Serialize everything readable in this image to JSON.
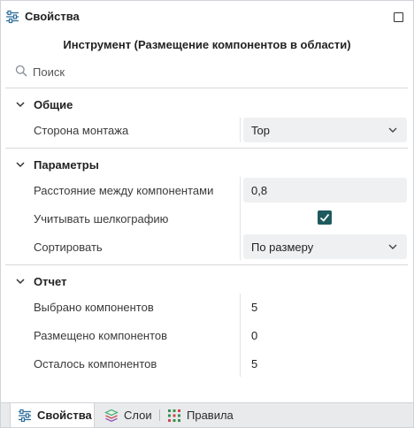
{
  "panel": {
    "title": "Свойства"
  },
  "tool_title": "Инструмент (Размещение компонентов в области)",
  "search": {
    "placeholder": "Поиск"
  },
  "sections": {
    "general": {
      "title": "Общие",
      "mount_side_label": "Сторона монтажа",
      "mount_side_value": "Top"
    },
    "parameters": {
      "title": "Параметры",
      "spacing_label": "Расстояние между компонентами",
      "spacing_value": "0,8",
      "silkscreen_label": "Учитывать шелкографию",
      "silkscreen_checked": true,
      "sort_label": "Сортировать",
      "sort_value": "По размеру"
    },
    "report": {
      "title": "Отчет",
      "selected_label": "Выбрано компонентов",
      "selected_value": "5",
      "placed_label": "Размещено компонентов",
      "placed_value": "0",
      "remaining_label": "Осталось компонентов",
      "remaining_value": "5"
    }
  },
  "tabs": [
    {
      "label": "Свойства",
      "icon": "sliders-icon",
      "active": true
    },
    {
      "label": "Слои",
      "icon": "layers-icon",
      "active": false
    },
    {
      "label": "Правила",
      "icon": "rules-grid-icon",
      "active": false
    }
  ],
  "colors": {
    "accent": "#1e5a5d",
    "field_bg": "#eff0f1",
    "tabbar_bg": "#e8eaec"
  }
}
